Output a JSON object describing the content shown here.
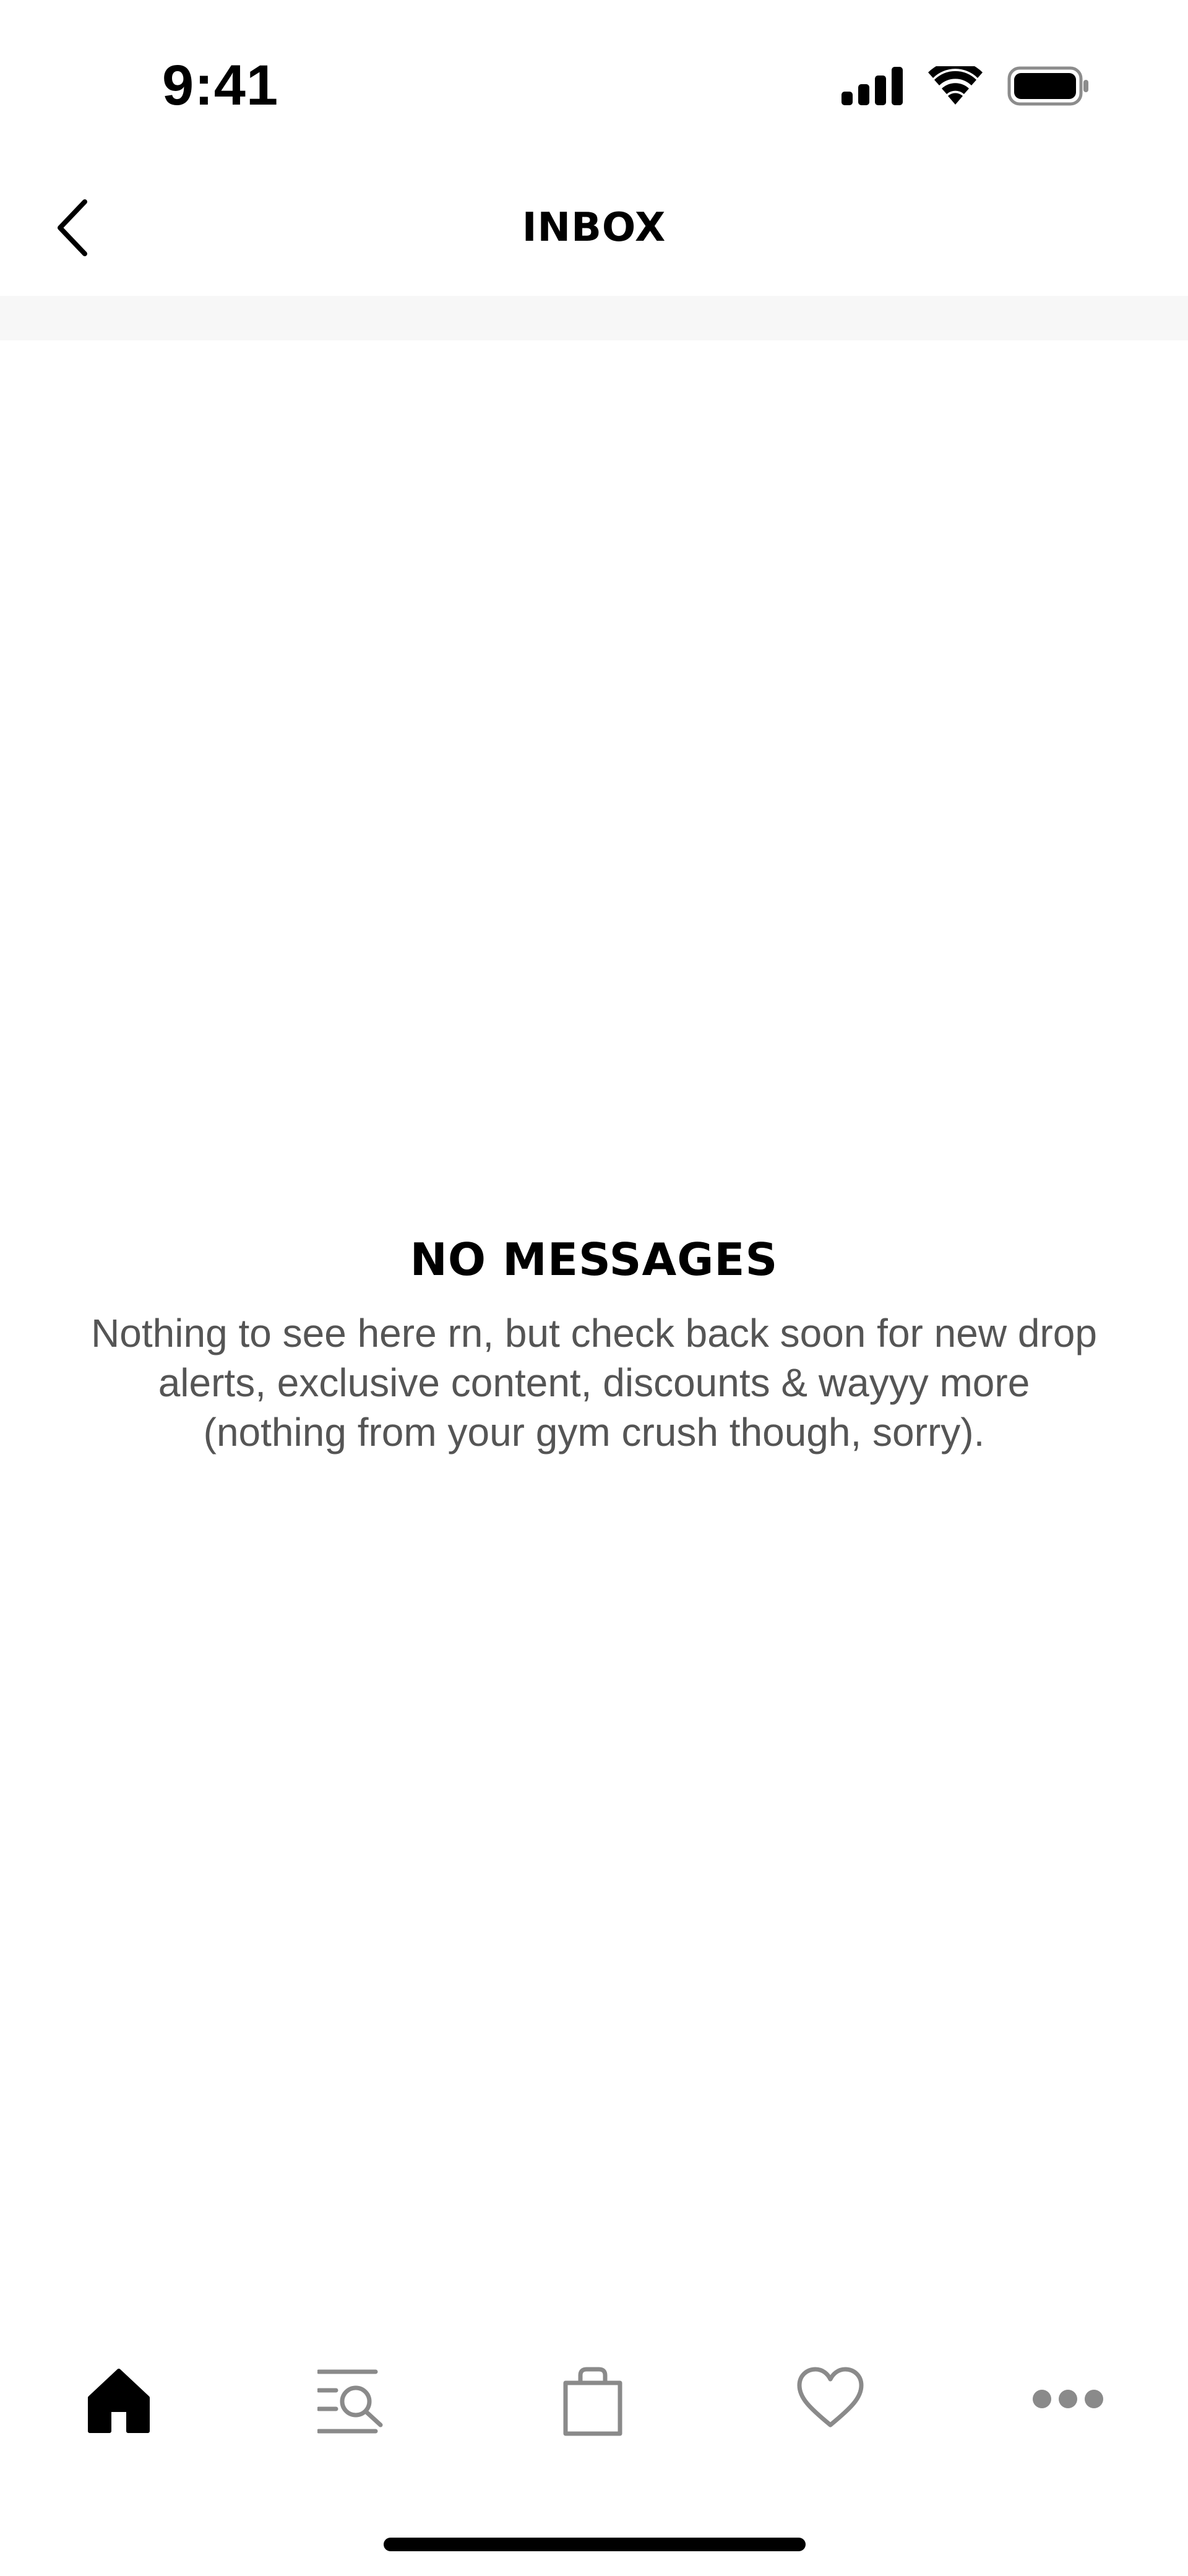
{
  "status_bar": {
    "time": "9:41",
    "icons": [
      "cellular-signal-icon",
      "wifi-icon",
      "battery-icon"
    ]
  },
  "header": {
    "back_icon": "chevron-left-icon",
    "title": "INBOX"
  },
  "empty_state": {
    "title": "NO MESSAGES",
    "message_lines": [
      "Nothing to see here rn, but check back soon for new drop",
      "alerts, exclusive content, discounts & wayyy more",
      "(nothing from your gym crush though, sorry)."
    ]
  },
  "tab_bar": {
    "tabs": [
      {
        "icon": "home-icon",
        "active": true
      },
      {
        "icon": "search-list-icon",
        "active": false
      },
      {
        "icon": "shopping-bag-icon",
        "active": false
      },
      {
        "icon": "heart-icon",
        "active": false
      },
      {
        "icon": "more-dots-icon",
        "active": false
      }
    ]
  },
  "colors": {
    "text_primary": "#000000",
    "text_secondary": "#555555",
    "icon_inactive": "#8a8a8a",
    "divider": "#f7f7f7",
    "background": "#ffffff"
  }
}
